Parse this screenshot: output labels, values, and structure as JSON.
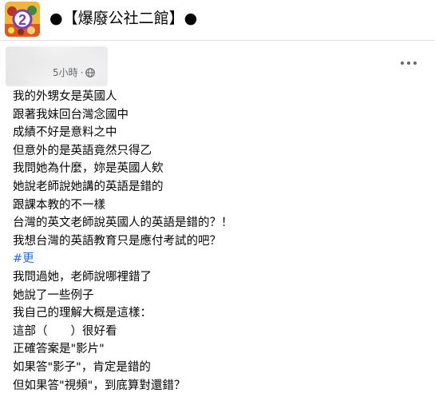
{
  "group": {
    "name": "●【爆廢公社二館】●"
  },
  "post": {
    "time": "5小時",
    "separator": "·",
    "lines_part1": [
      "我的外甥女是英國人",
      "跟著我妹回台灣念國中",
      "成績不好是意料之中",
      "但意外的是英語竟然只得乙",
      "我問她為什麼，妳是英國人欸",
      "她說老師說她講的英語是錯的",
      "跟課本教的不一樣",
      "台灣的英文老師說英國人的英語是錯的？！",
      "我想台灣的英語教育只是應付考試的吧？"
    ],
    "hashtag": "#更",
    "lines_part2": [
      "我問過她，老師說哪裡錯了",
      "她說了一些例子",
      "我自己的理解大概是這樣：",
      "這部（　　）很好看",
      "正確答案是\"影片\"",
      "如果答\"影子\"，肯定是錯的",
      "但如果答\"視頻\"，到底算對還錯？"
    ]
  },
  "icons": {
    "group_icon": "group-cover-icon",
    "privacy": "globe-icon",
    "menu": "more-options-icon"
  }
}
